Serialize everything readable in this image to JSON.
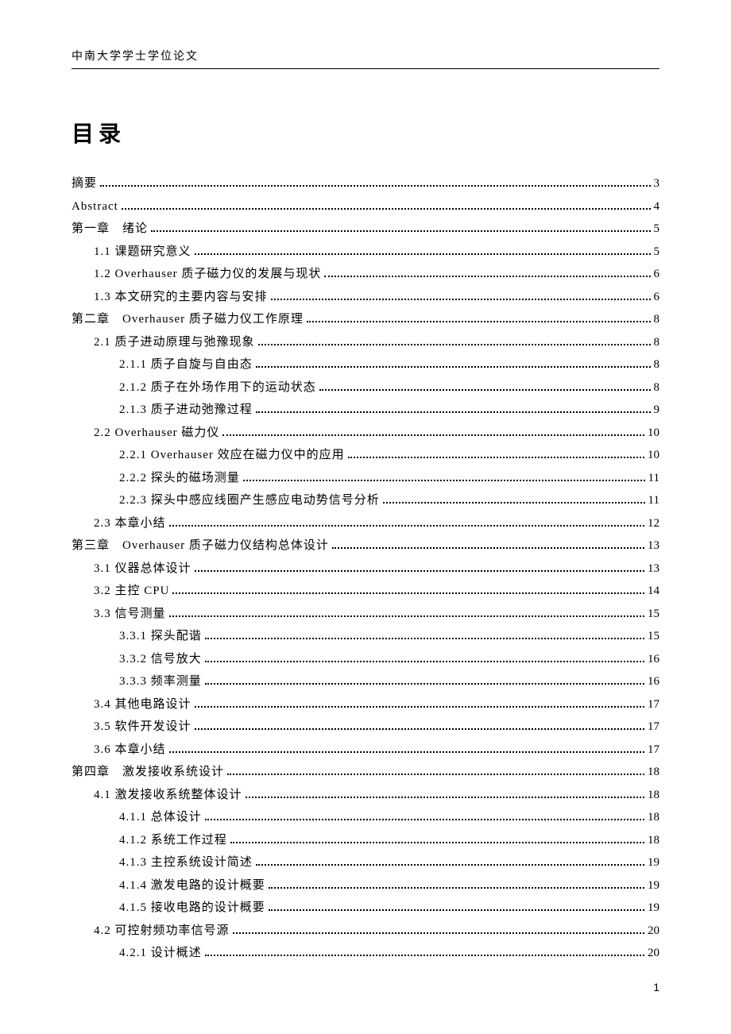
{
  "header": "中南大学学士学位论文",
  "title": "目录",
  "page_number": "1",
  "toc": [
    {
      "level": 0,
      "label": "摘要",
      "page": "3"
    },
    {
      "level": 0,
      "label": "Abstract",
      "page": "4"
    },
    {
      "level": 0,
      "label": "第一章　绪论",
      "page": "5"
    },
    {
      "level": 1,
      "label": "1.1 课题研究意义",
      "page": "5"
    },
    {
      "level": 1,
      "label": "1.2 Overhauser 质子磁力仪的发展与现状",
      "page": "6"
    },
    {
      "level": 1,
      "label": "1.3 本文研究的主要内容与安排",
      "page": "6"
    },
    {
      "level": 0,
      "label": "第二章　Overhauser 质子磁力仪工作原理",
      "page": "8"
    },
    {
      "level": 1,
      "label": "2.1 质子进动原理与弛豫现象",
      "page": "8"
    },
    {
      "level": 2,
      "label": "2.1.1 质子自旋与自由态",
      "page": "8"
    },
    {
      "level": 2,
      "label": "2.1.2 质子在外场作用下的运动状态",
      "page": "8"
    },
    {
      "level": 2,
      "label": "2.1.3 质子进动弛豫过程",
      "page": "9"
    },
    {
      "level": 1,
      "label": "2.2 Overhauser 磁力仪",
      "page": "10"
    },
    {
      "level": 2,
      "label": "2.2.1 Overhauser 效应在磁力仪中的应用",
      "page": "10"
    },
    {
      "level": 2,
      "label": "2.2.2 探头的磁场测量",
      "page": "11"
    },
    {
      "level": 2,
      "label": "2.2.3 探头中感应线圈产生感应电动势信号分析",
      "page": "11"
    },
    {
      "level": 1,
      "label": "2.3 本章小结",
      "page": "12"
    },
    {
      "level": 0,
      "label": "第三章　Overhauser 质子磁力仪结构总体设计",
      "page": "13"
    },
    {
      "level": 1,
      "label": "3.1 仪器总体设计",
      "page": "13"
    },
    {
      "level": 1,
      "label": "3.2 主控 CPU",
      "page": "14"
    },
    {
      "level": 1,
      "label": "3.3 信号测量",
      "page": "15"
    },
    {
      "level": 2,
      "label": "3.3.1 探头配谐",
      "page": "15"
    },
    {
      "level": 2,
      "label": "3.3.2 信号放大",
      "page": "16"
    },
    {
      "level": 2,
      "label": "3.3.3 频率测量",
      "page": "16"
    },
    {
      "level": 1,
      "label": "3.4 其他电路设计",
      "page": "17"
    },
    {
      "level": 1,
      "label": "3.5 软件开发设计",
      "page": "17"
    },
    {
      "level": 1,
      "label": "3.6 本章小结",
      "page": "17"
    },
    {
      "level": 0,
      "label": "第四章　激发接收系统设计",
      "page": "18"
    },
    {
      "level": 1,
      "label": "4.1 激发接收系统整体设计",
      "page": "18"
    },
    {
      "level": 2,
      "label": "4.1.1 总体设计",
      "page": "18"
    },
    {
      "level": 2,
      "label": "4.1.2 系统工作过程",
      "page": "18"
    },
    {
      "level": 2,
      "label": "4.1.3 主控系统设计简述",
      "page": "19"
    },
    {
      "level": 2,
      "label": "4.1.4 激发电路的设计概要",
      "page": "19"
    },
    {
      "level": 2,
      "label": "4.1.5 接收电路的设计概要",
      "page": "19"
    },
    {
      "level": 1,
      "label": "4.2 可控射频功率信号源",
      "page": "20"
    },
    {
      "level": 2,
      "label": "4.2.1 设计概述",
      "page": "20"
    }
  ]
}
